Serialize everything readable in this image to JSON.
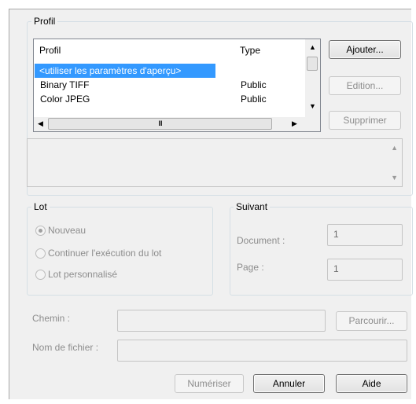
{
  "profil": {
    "group_title": "Profil",
    "list": {
      "col_profil": "Profil",
      "col_type": "Type",
      "rows": [
        {
          "name": "<utiliser les paramètres d'aperçu>",
          "type": ""
        },
        {
          "name": "Binary TIFF",
          "type": "Public"
        },
        {
          "name": "Color JPEG",
          "type": "Public"
        }
      ],
      "h_thumb": "III"
    },
    "buttons": {
      "add": "Ajouter...",
      "edit": "Edition...",
      "delete": "Supprimer"
    }
  },
  "lot": {
    "group_title": "Lot",
    "options": [
      "Nouveau",
      "Continuer l'exécution du lot",
      "Lot personnalisé"
    ]
  },
  "suivant": {
    "group_title": "Suivant",
    "document_label": "Document :",
    "document_value": "1",
    "page_label": "Page :",
    "page_value": "1"
  },
  "paths": {
    "chemin_label": "Chemin :",
    "browse": "Parcourir...",
    "filename_label": "Nom de fichier :"
  },
  "footer": {
    "scan": "Numériser",
    "cancel": "Annuler",
    "help": "Aide"
  }
}
